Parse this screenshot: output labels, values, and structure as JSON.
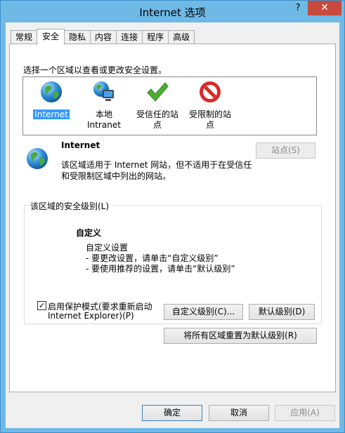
{
  "window": {
    "title": "Internet 选项",
    "help_label": "?",
    "close_label": "✕"
  },
  "tabs": [
    {
      "label": "常规"
    },
    {
      "label": "安全"
    },
    {
      "label": "隐私"
    },
    {
      "label": "内容"
    },
    {
      "label": "连接"
    },
    {
      "label": "程序"
    },
    {
      "label": "高级"
    }
  ],
  "security": {
    "select_prompt": "选择一个区域以查看或更改安全设置。",
    "zones": [
      {
        "line1": "Internet",
        "line2": "",
        "icon": "globe-icon",
        "selected": true
      },
      {
        "line1": "本地",
        "line2": "Intranet",
        "icon": "intranet-icon",
        "selected": false
      },
      {
        "line1": "受信任的站",
        "line2": "点",
        "icon": "checkmark-icon",
        "selected": false
      },
      {
        "line1": "受限制的站",
        "line2": "点",
        "icon": "restricted-icon",
        "selected": false
      }
    ],
    "zone_info": {
      "name": "Internet",
      "desc_line1": "该区域适用于 Internet 网站，但不适用于在受信任",
      "desc_line2": "和受限制区域中列出的网站。",
      "sites_button": "站点(S)"
    },
    "level_group": {
      "title": "该区域的安全级别(L)",
      "level_name": "自定义",
      "custom_line1": "自定义设置",
      "custom_line2": "- 要更改设置，请单击“自定义级别”",
      "custom_line3": "- 要使用推荐的设置，请单击“默认级别”",
      "protected_mode_line1": "启用保护模式(要求重新启动",
      "protected_mode_line2": "Internet Explorer)(P)",
      "protected_mode_checked": true,
      "custom_level_button": "自定义级别(C)...",
      "default_level_button": "默认级别(D)"
    },
    "reset_all_button": "将所有区域重置为默认级别(R)"
  },
  "footer": {
    "ok": "确定",
    "cancel": "取消",
    "apply": "应用(A)"
  }
}
